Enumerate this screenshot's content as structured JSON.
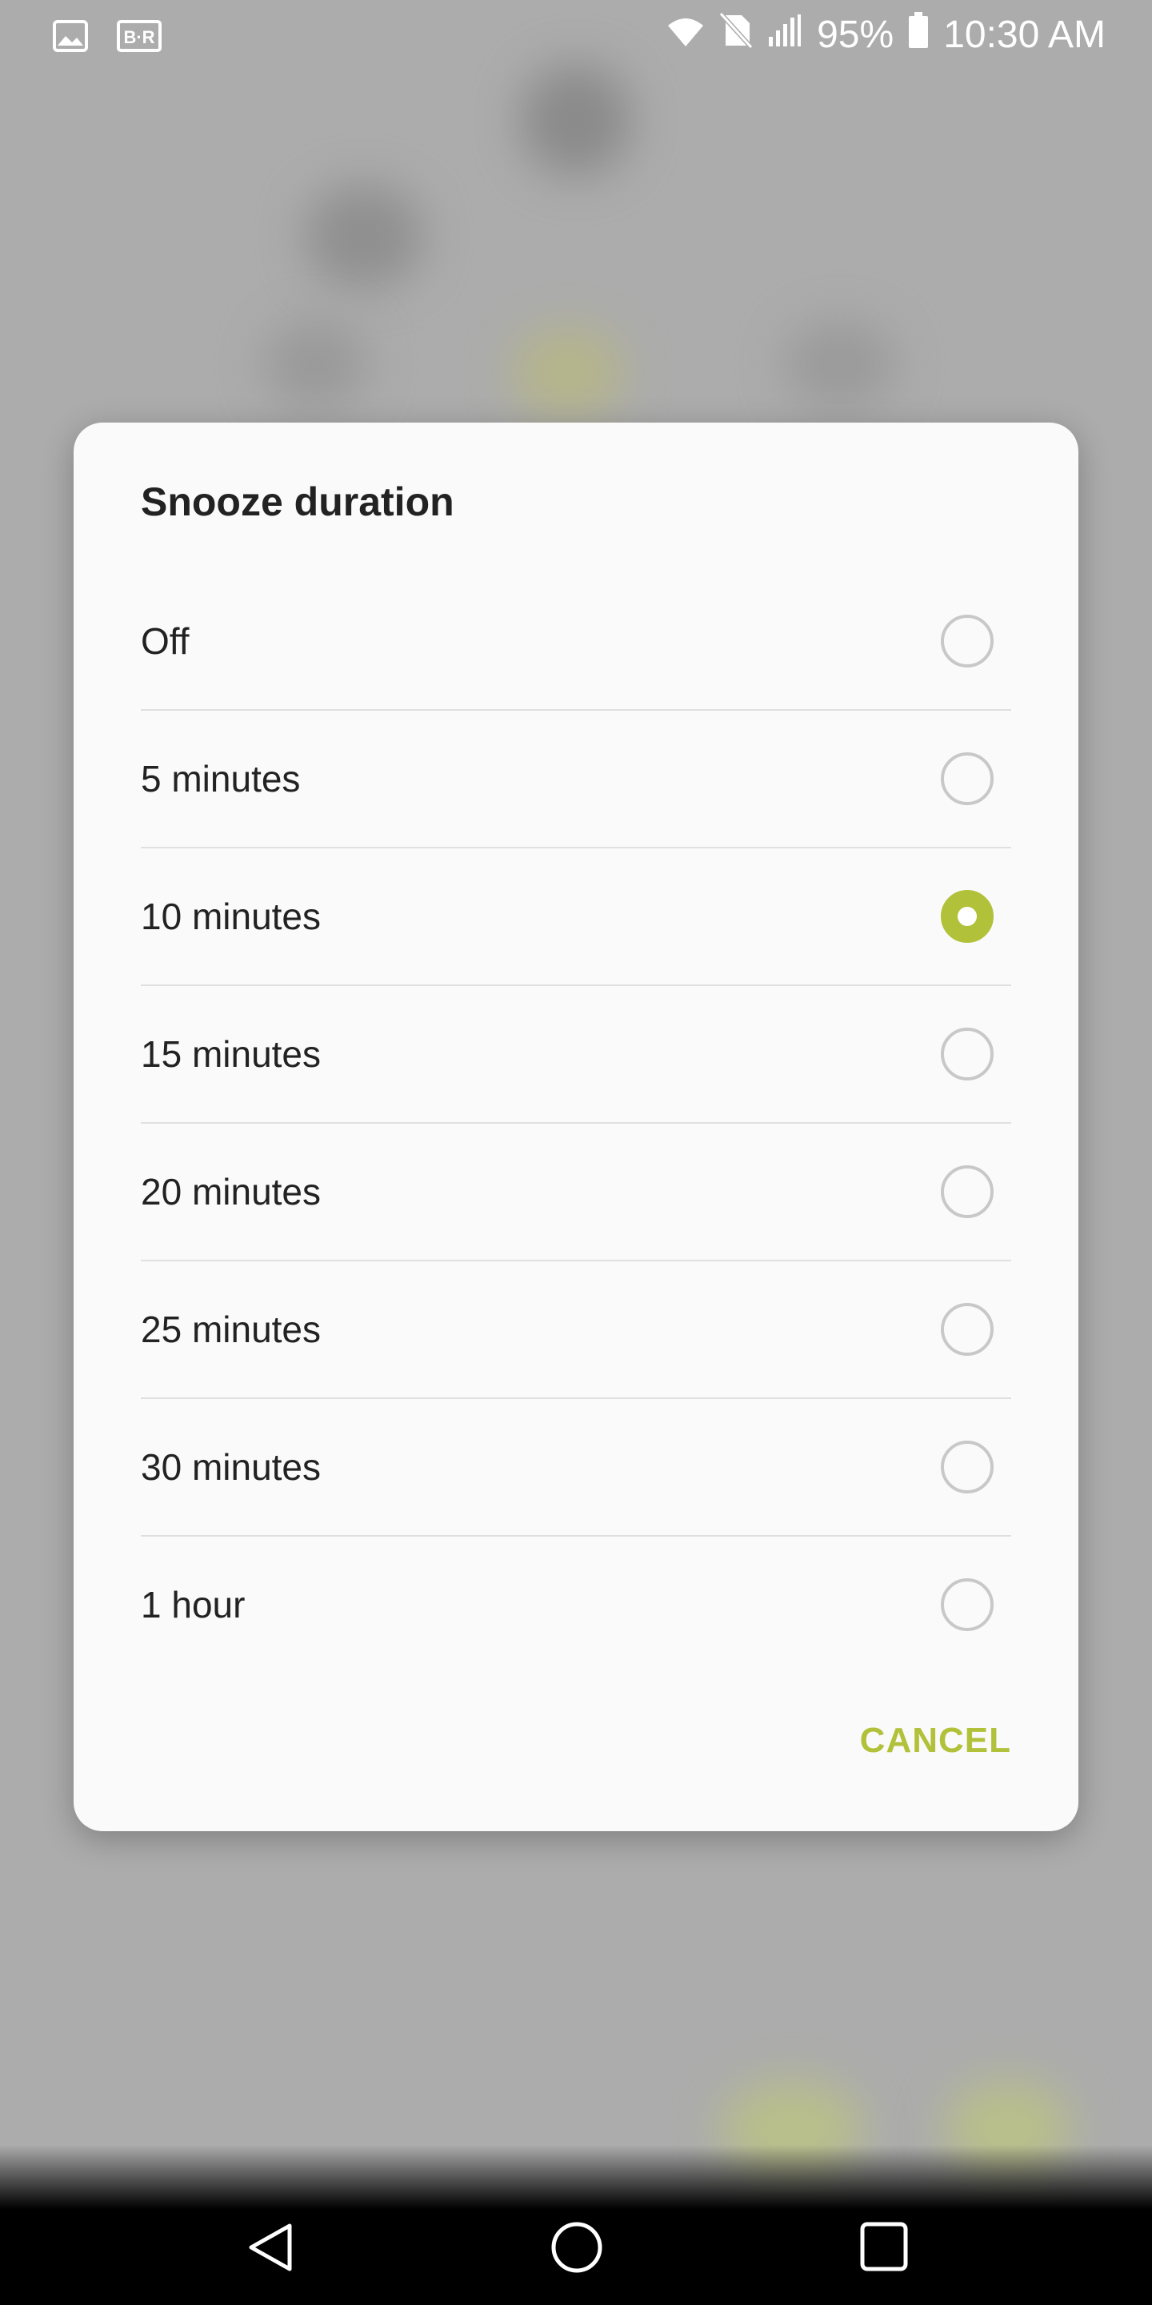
{
  "status_bar": {
    "left_icons": [
      "gallery-icon",
      "bleacher-report-icon"
    ],
    "right_icons": [
      "wifi-icon",
      "no-sim-icon",
      "signal-icon",
      "battery-icon"
    ],
    "battery": "95%",
    "time": "10:30 AM"
  },
  "dialog": {
    "title": "Snooze duration",
    "options": [
      {
        "label": "Off",
        "selected": false
      },
      {
        "label": "5 minutes",
        "selected": false
      },
      {
        "label": "10 minutes",
        "selected": true
      },
      {
        "label": "15 minutes",
        "selected": false
      },
      {
        "label": "20 minutes",
        "selected": false
      },
      {
        "label": "25 minutes",
        "selected": false
      },
      {
        "label": "30 minutes",
        "selected": false
      },
      {
        "label": "1 hour",
        "selected": false
      }
    ],
    "cancel_label": "CANCEL"
  },
  "nav_bar": {
    "buttons": [
      "back-icon",
      "home-icon",
      "recents-icon"
    ]
  },
  "colors": {
    "accent": "#b2c13a",
    "scrim": "#acacac",
    "dialog_bg": "#fafafa"
  }
}
